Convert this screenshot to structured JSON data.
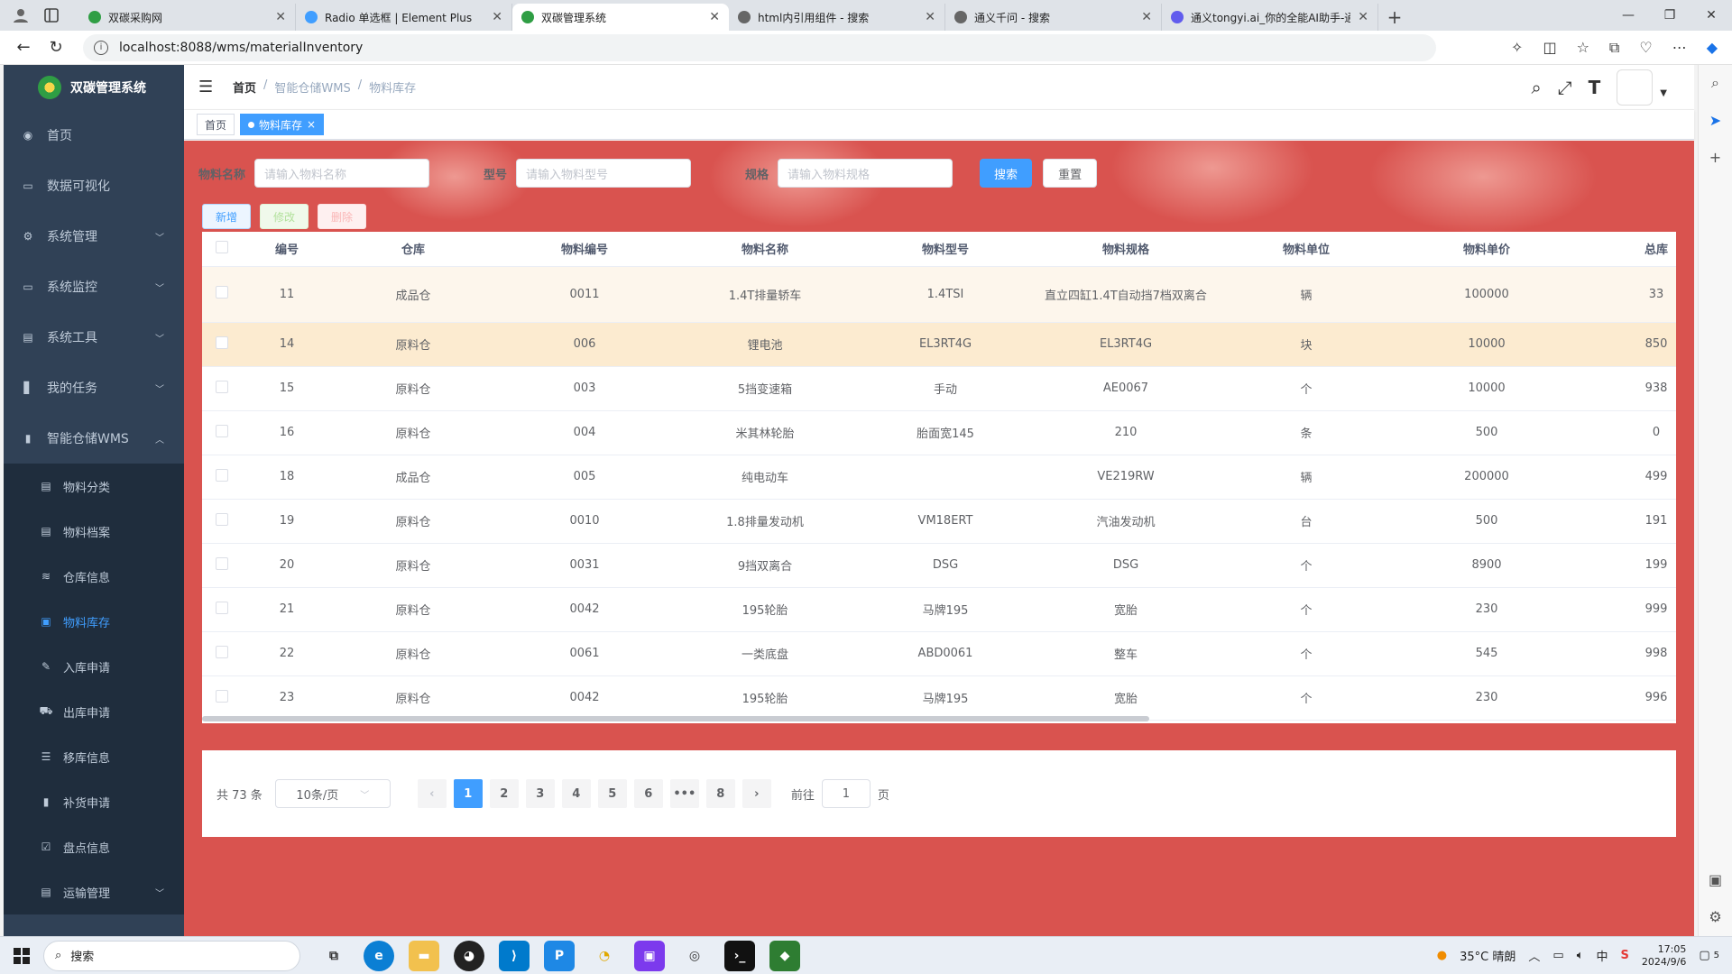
{
  "browser": {
    "tabs": [
      {
        "title": "双碳采购网",
        "color": "#2f9e44"
      },
      {
        "title": "Radio 单选框 | Element Plus",
        "color": "#409eff"
      },
      {
        "title": "双碳管理系统",
        "color": "#2f9e44",
        "active": true
      },
      {
        "title": "html内引用组件 - 搜索",
        "color": "#666666"
      },
      {
        "title": "通义千问 - 搜索",
        "color": "#666666"
      },
      {
        "title": "通义tongyi.ai_你的全能AI助手-通",
        "color": "#615ced"
      }
    ],
    "new_tab": "+",
    "url": "localhost:8088/wms/materialInventory"
  },
  "sidebar": {
    "logo_text": "双碳管理系统",
    "items": [
      {
        "label": "首页",
        "icon": "dashboard-icon"
      },
      {
        "label": "数据可视化",
        "icon": "monitor-icon"
      },
      {
        "label": "系统管理",
        "icon": "gear-icon",
        "arrow": "﹀"
      },
      {
        "label": "系统监控",
        "icon": "monitor-icon",
        "arrow": "﹀"
      },
      {
        "label": "系统工具",
        "icon": "toolbox-icon",
        "arrow": "﹀"
      },
      {
        "label": "我的任务",
        "icon": "book-icon",
        "arrow": "﹀"
      },
      {
        "label": "智能仓储WMS",
        "icon": "chart-icon",
        "arrow": "︿"
      }
    ],
    "sub_items": [
      {
        "label": "物料分类",
        "icon": "document-icon"
      },
      {
        "label": "物料档案",
        "icon": "document-icon"
      },
      {
        "label": "仓库信息",
        "icon": "layers-icon"
      },
      {
        "label": "物料库存",
        "icon": "inventory-icon",
        "active": true
      },
      {
        "label": "入库申请",
        "icon": "edit-icon"
      },
      {
        "label": "出库申请",
        "icon": "cart-icon"
      },
      {
        "label": "移库信息",
        "icon": "list-icon"
      },
      {
        "label": "补货申请",
        "icon": "chart-icon"
      },
      {
        "label": "盘点信息",
        "icon": "checkbox-icon"
      },
      {
        "label": "运输管理",
        "icon": "toolbox-icon",
        "arrow": "﹀"
      }
    ]
  },
  "navbar": {
    "breadcrumbs": [
      "首页",
      "智能仓储WMS",
      "物料库存"
    ],
    "separator": "/"
  },
  "tags": [
    {
      "label": "首页"
    },
    {
      "label": "物料库存",
      "active": true,
      "close": "×"
    }
  ],
  "search": {
    "fields": [
      {
        "label": "物料名称",
        "placeholder": "请输入物料名称"
      },
      {
        "label": "型号",
        "placeholder": "请输入物料型号"
      },
      {
        "label": "规格",
        "placeholder": "请输入物料规格"
      }
    ],
    "search_label": "搜索",
    "reset_label": "重置"
  },
  "toolbar": {
    "add_label": "新增",
    "edit_label": "修改",
    "delete_label": "删除"
  },
  "table": {
    "columns": [
      "编号",
      "仓库",
      "物料编号",
      "物料名称",
      "物料型号",
      "物料规格",
      "物料单位",
      "物料单价",
      "总库"
    ],
    "rows": [
      [
        "11",
        "成品仓",
        "0011",
        "1.4T排量轿车",
        "1.4TSI",
        "直立四缸1.4T自动挡7档双离合",
        "辆",
        "100000",
        "33"
      ],
      [
        "14",
        "原料仓",
        "006",
        "锂电池",
        "EL3RT4G",
        "EL3RT4G",
        "块",
        "10000",
        "850"
      ],
      [
        "15",
        "原料仓",
        "003",
        "5挡变速箱",
        "手动",
        "AE0067",
        "个",
        "10000",
        "938"
      ],
      [
        "16",
        "原料仓",
        "004",
        "米其林轮胎",
        "胎面宽145",
        "210",
        "条",
        "500",
        "0"
      ],
      [
        "18",
        "成品仓",
        "005",
        "纯电动车",
        "",
        "VE219RW",
        "辆",
        "200000",
        "499"
      ],
      [
        "19",
        "原料仓",
        "0010",
        "1.8排量发动机",
        "VM18ERT",
        "汽油发动机",
        "台",
        "500",
        "191"
      ],
      [
        "20",
        "原料仓",
        "0031",
        "9挡双离合",
        "DSG",
        "DSG",
        "个",
        "8900",
        "199"
      ],
      [
        "21",
        "原料仓",
        "0042",
        "195轮胎",
        "马牌195",
        "宽胎",
        "个",
        "230",
        "999"
      ],
      [
        "22",
        "原料仓",
        "0061",
        "一类底盘",
        "ABD0061",
        "整车",
        "个",
        "545",
        "998"
      ],
      [
        "23",
        "原料仓",
        "0042",
        "195轮胎",
        "马牌195",
        "宽胎",
        "个",
        "230",
        "996"
      ]
    ]
  },
  "pagination": {
    "total": "共 73 条",
    "page_size": "10条/页",
    "pages": [
      "1",
      "2",
      "3",
      "4",
      "5",
      "6",
      "•••",
      "8"
    ],
    "current": "1",
    "prev": "‹",
    "next": "›",
    "goto_label": "前往",
    "goto_value": "1",
    "goto_suffix": "页"
  },
  "taskbar": {
    "search_placeholder": "搜索",
    "weather": "35°C 晴朗",
    "ime": "中",
    "time": "17:05",
    "date": "2024/9/6",
    "notification_count": "5"
  }
}
